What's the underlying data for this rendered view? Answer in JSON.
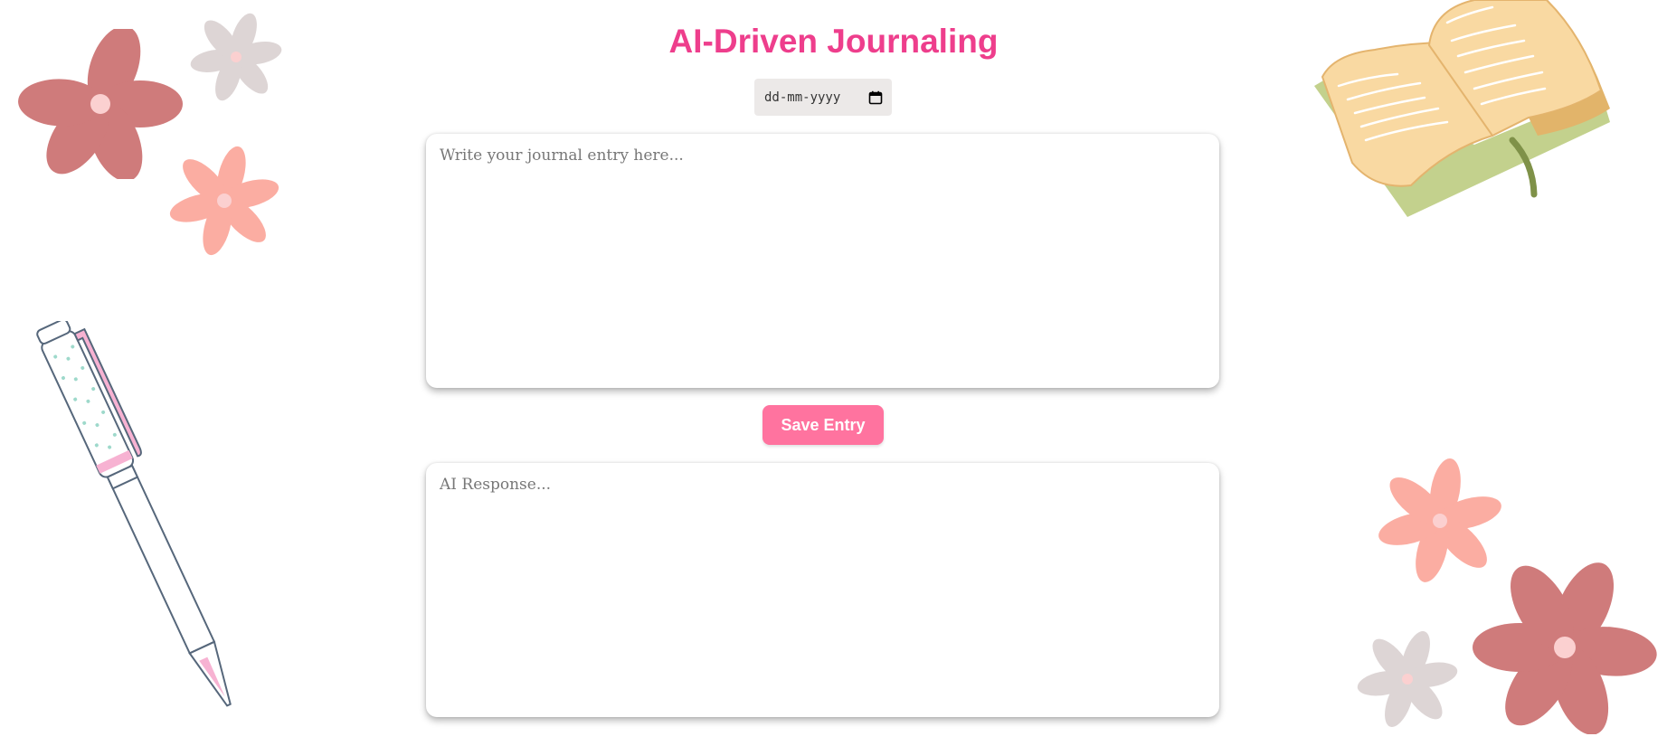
{
  "page": {
    "title": "AI-Driven Journaling"
  },
  "date_picker": {
    "placeholder_text": "dd-mm-yyyy",
    "icon": "calendar-icon"
  },
  "journal_entry": {
    "placeholder": "Write your journal entry here...",
    "value": ""
  },
  "save_button": {
    "label": "Save Entry"
  },
  "ai_response": {
    "placeholder": "AI Response...",
    "value": ""
  },
  "decorations": {
    "top_left": [
      "flower-icon",
      "flower-icon",
      "flower-icon"
    ],
    "left": "pen-icon",
    "top_right": "open-book-icon",
    "bottom_right": [
      "flower-icon",
      "flower-icon",
      "flower-icon"
    ]
  },
  "colors": {
    "title": "#ee3e8c",
    "button": "#ff739f",
    "date_field_bg": "#ece9e8",
    "flower_dark": "#cf7b7b",
    "flower_salmon": "#fbada2",
    "flower_grey": "#ddd5d5",
    "flower_center": "#fbd0d0",
    "book_pages": "#f9d9a2",
    "book_cover": "#c3d18d",
    "pen_outline": "#56677b",
    "pen_pink": "#f7b2d2",
    "pen_dots": "#9ed9cb"
  }
}
